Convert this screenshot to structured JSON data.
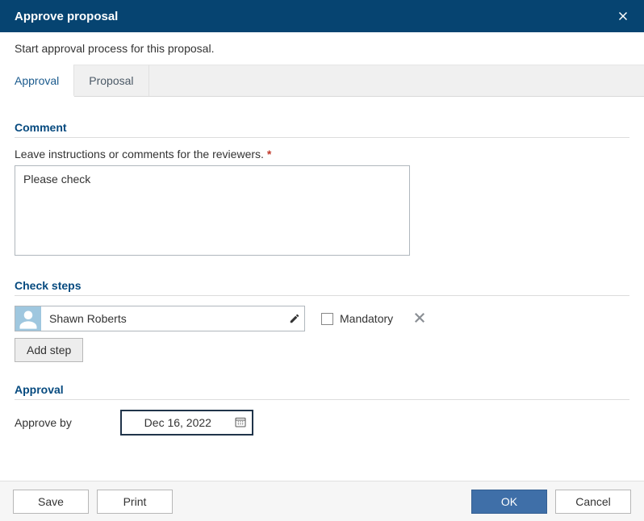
{
  "header": {
    "title": "Approve proposal"
  },
  "intro": "Start approval process for this proposal.",
  "tabs": [
    "Approval",
    "Proposal"
  ],
  "comment": {
    "section": "Comment",
    "label": "Leave instructions or comments for the reviewers.",
    "value": "Please check"
  },
  "steps": {
    "section": "Check steps",
    "items": [
      {
        "name": "Shawn Roberts",
        "mandatory": false
      }
    ],
    "mandatory_label": "Mandatory",
    "add_label": "Add step"
  },
  "approval": {
    "section": "Approval",
    "label": "Approve by",
    "date": "Dec 16, 2022"
  },
  "footer": {
    "save": "Save",
    "print": "Print",
    "ok": "OK",
    "cancel": "Cancel"
  }
}
